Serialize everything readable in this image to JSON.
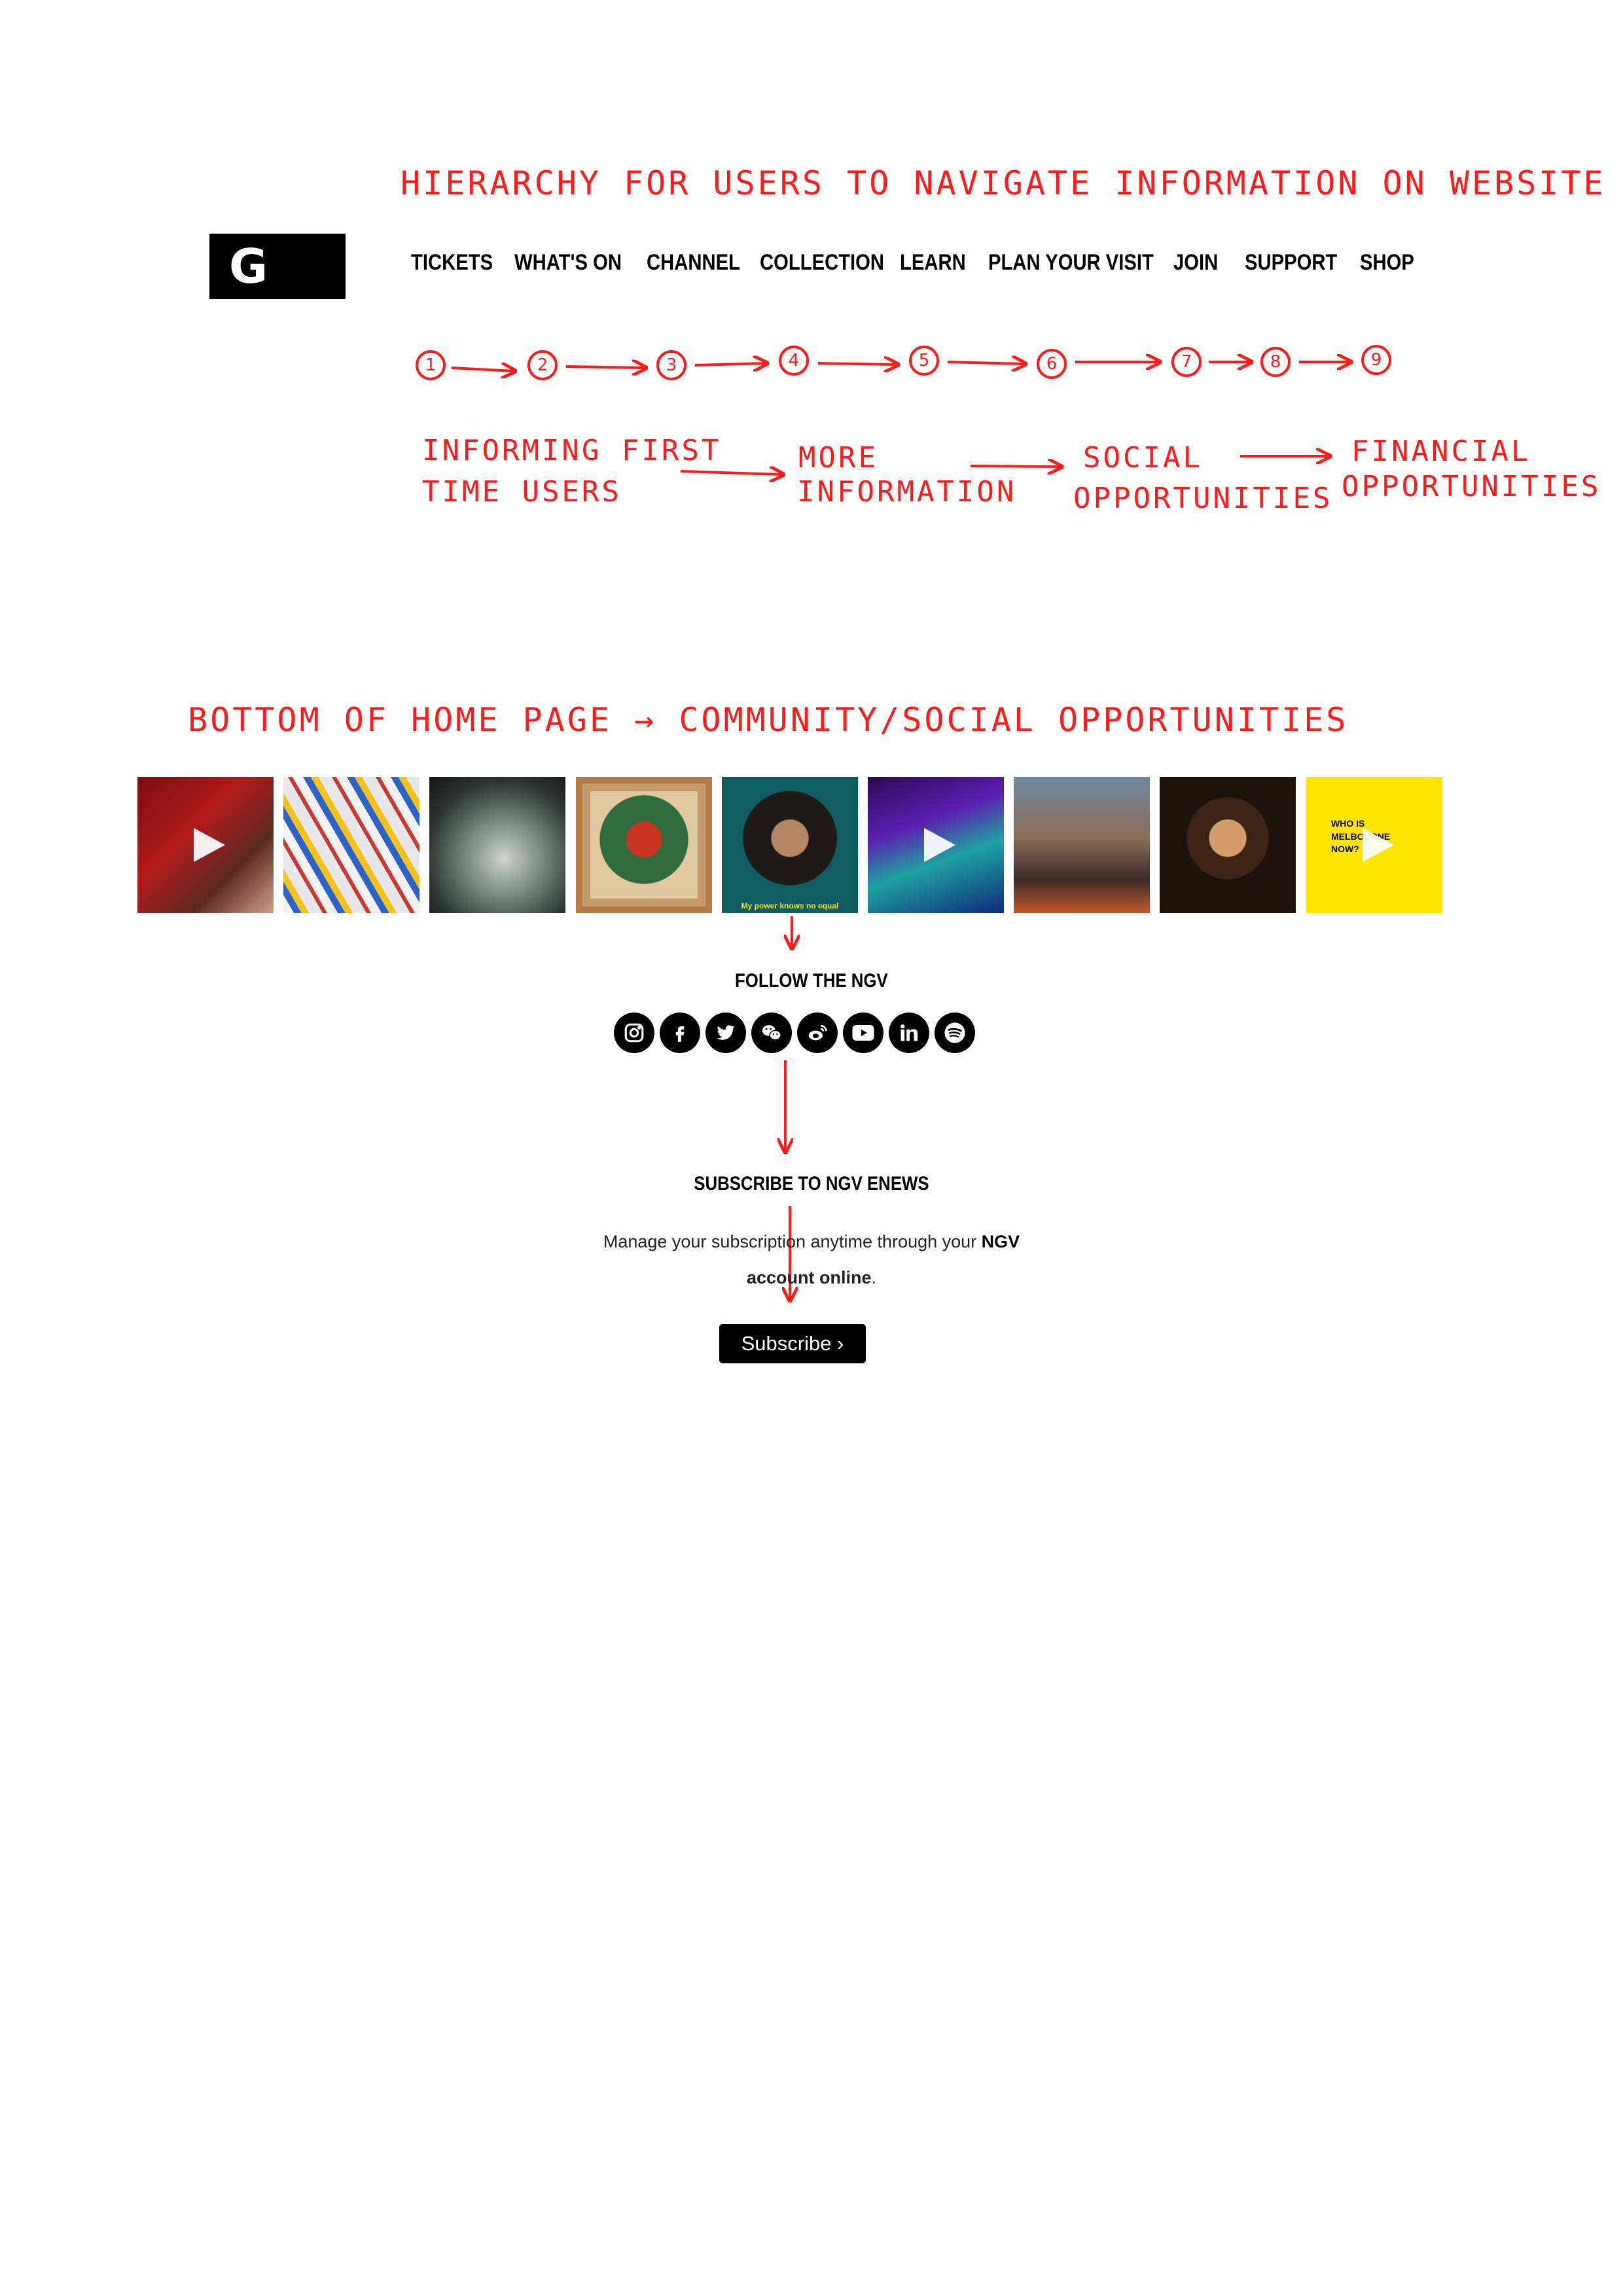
{
  "annotations": {
    "hierarchy_title": "HIERARCHY FOR USERS TO NAVIGATE INFORMATION ON WEBSITE",
    "steps": [
      "1",
      "2",
      "3",
      "4",
      "5",
      "6",
      "7",
      "8",
      "9"
    ],
    "stages": [
      "INFORMING FIRST",
      "TIME USERS",
      "MORE",
      "INFORMATION",
      "SOCIAL",
      "OPPORTUNITIES",
      "FINANCIAL",
      "OPPORTUNITIES"
    ],
    "bottom_title": "BOTTOM OF HOME PAGE → COMMUNITY/SOCIAL OPPORTUNITIES",
    "color": "#ff1a1a"
  },
  "header": {
    "logo": "N G V",
    "nav": [
      "TICKETS",
      "WHAT'S ON",
      "CHANNEL",
      "COLLECTION",
      "LEARN",
      "PLAN YOUR VISIT",
      "JOIN",
      "SUPPORT",
      "SHOP"
    ]
  },
  "feed": {
    "tiles": [
      {
        "label": "",
        "video": true
      },
      {
        "label": "",
        "video": false
      },
      {
        "label": "",
        "video": false
      },
      {
        "label": "",
        "video": false
      },
      {
        "label": "My power knows no equal",
        "video": false
      },
      {
        "label": "",
        "video": true
      },
      {
        "label": "",
        "video": false
      },
      {
        "label": "",
        "video": false
      },
      {
        "label": "WHO IS MELBOURNE NOW?",
        "video": true
      }
    ]
  },
  "follow": {
    "title": "FOLLOW THE NGV",
    "icons": [
      "instagram-icon",
      "facebook-icon",
      "twitter-icon",
      "wechat-icon",
      "weibo-icon",
      "youtube-icon",
      "linkedin-icon",
      "spotify-icon"
    ]
  },
  "subscribe": {
    "title": "SUBSCRIBE TO NGV ENEWS",
    "text_before": "Manage your subscription anytime through your ",
    "link_ngv": "NGV",
    "link_account": "account online",
    "text_after": ".",
    "button": "Subscribe ›"
  }
}
